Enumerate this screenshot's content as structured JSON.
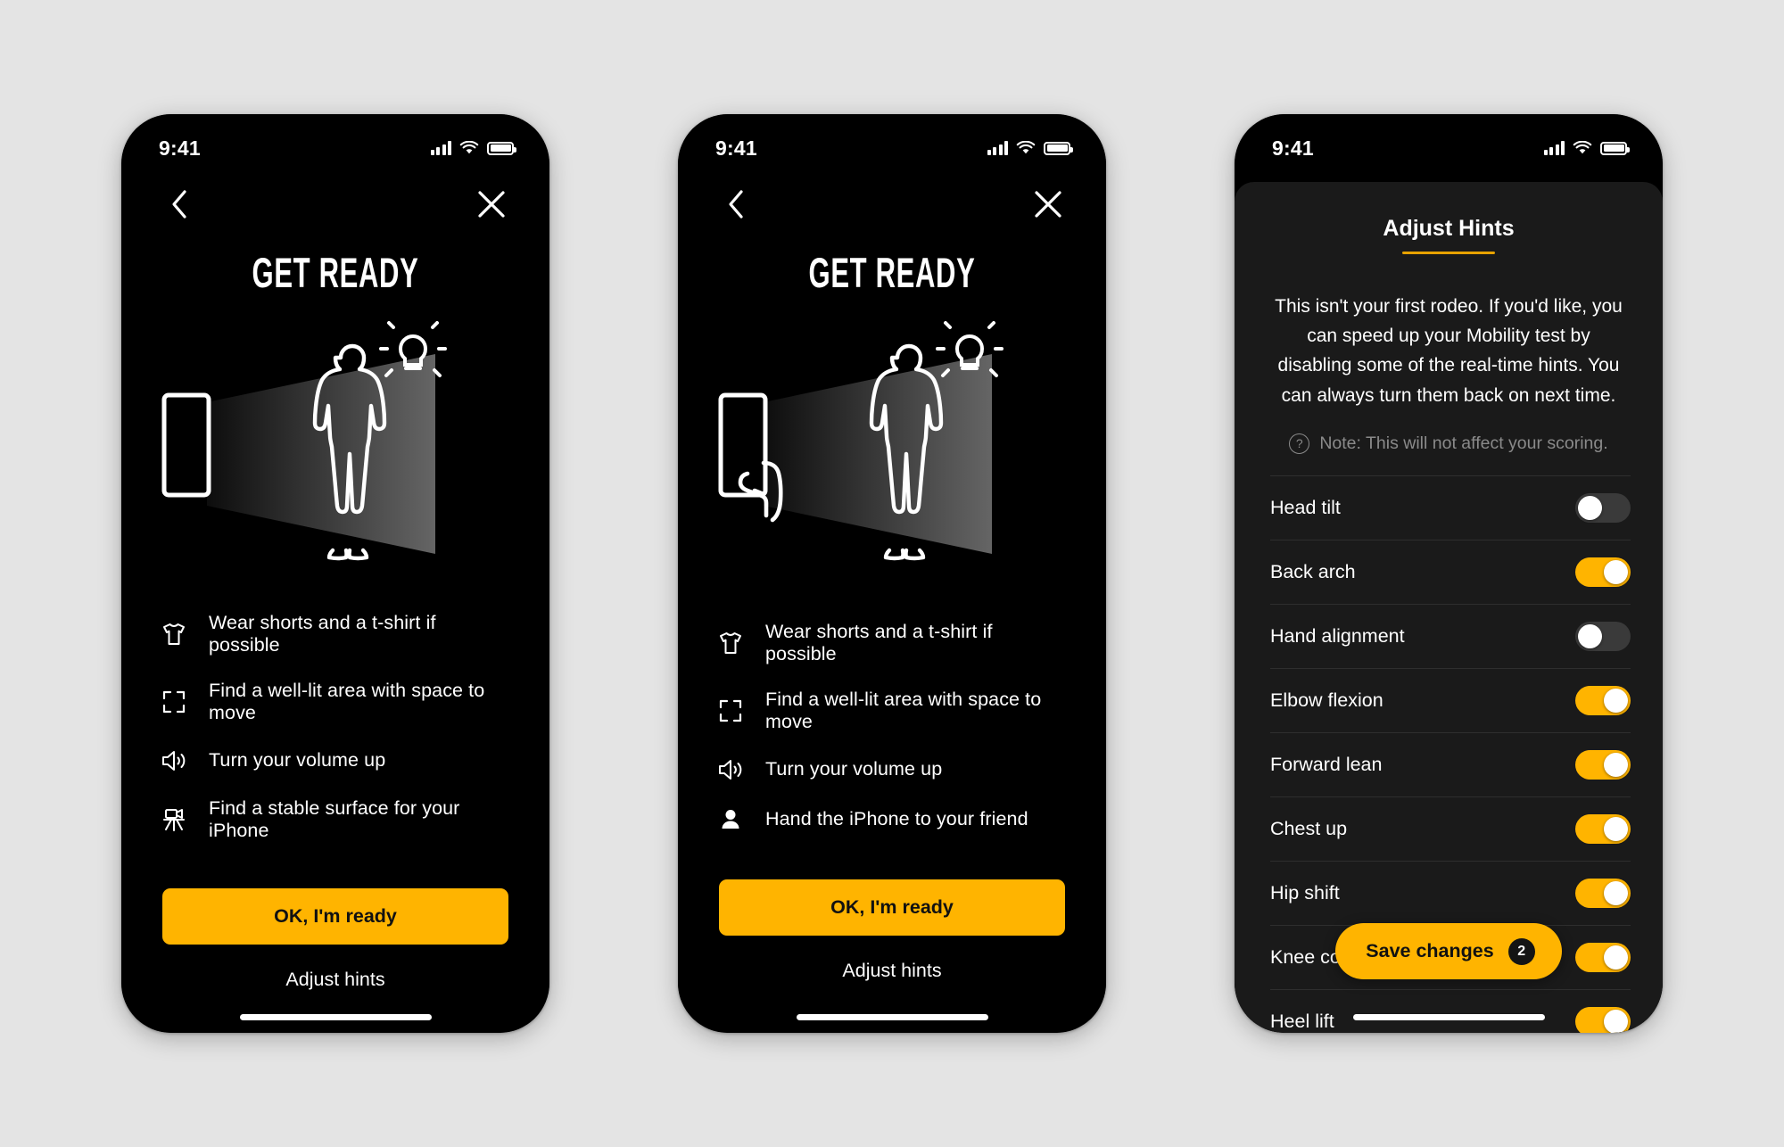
{
  "background_color": "#e4e4e4",
  "accent_color": "#FFB400",
  "underline_color": "#E8A200",
  "status_bar": {
    "time": "9:41",
    "signal_icon": "cellular-bars-icon",
    "wifi_icon": "wifi-icon",
    "battery_icon": "battery-full-icon"
  },
  "screens": [
    {
      "id": "get-ready-solo",
      "back_icon": "chevron-left-icon",
      "close_icon": "close-icon",
      "title": "GET READY",
      "illustration": "phone-camera-cone-person-lightbulb",
      "hints": [
        {
          "icon": "tshirt-icon",
          "text": "Wear shorts and a t-shirt if possible"
        },
        {
          "icon": "viewfinder-icon",
          "text": "Find a well-lit area with space to move"
        },
        {
          "icon": "speaker-wave-icon",
          "text": "Turn your volume up"
        },
        {
          "icon": "tripod-icon",
          "text": "Find a stable surface for your iPhone"
        }
      ],
      "primary_button": "OK, I'm ready",
      "secondary_link": "Adjust hints"
    },
    {
      "id": "get-ready-friend",
      "back_icon": "chevron-left-icon",
      "close_icon": "close-icon",
      "title": "GET READY",
      "illustration": "hand-holding-phone-cone-person-lightbulb",
      "hints": [
        {
          "icon": "tshirt-icon",
          "text": "Wear shorts and a t-shirt if possible"
        },
        {
          "icon": "viewfinder-icon",
          "text": "Find a well-lit area with space to move"
        },
        {
          "icon": "speaker-wave-icon",
          "text": "Turn your volume up"
        },
        {
          "icon": "person-icon",
          "text": "Hand the iPhone to your friend"
        }
      ],
      "primary_button": "OK, I'm ready",
      "secondary_link": "Adjust hints"
    }
  ],
  "adjust_hints_sheet": {
    "title": "Adjust Hints",
    "body": "This isn't your first rodeo. If you'd like, you can speed up your Mobility test by disabling some of the real-time hints. You can always turn them back on next time.",
    "note_icon": "question-circle-icon",
    "note": "Note: This will not affect your scoring.",
    "toggles": [
      {
        "label": "Head tilt",
        "on": false
      },
      {
        "label": "Back arch",
        "on": true
      },
      {
        "label": "Hand alignment",
        "on": false
      },
      {
        "label": "Elbow flexion",
        "on": true
      },
      {
        "label": "Forward lean",
        "on": true
      },
      {
        "label": "Chest up",
        "on": true
      },
      {
        "label": "Hip shift",
        "on": true
      },
      {
        "label": "Knee collapse",
        "on": true
      },
      {
        "label": "Heel lift",
        "on": true
      }
    ],
    "save_button": "Save changes",
    "save_badge": "2"
  }
}
